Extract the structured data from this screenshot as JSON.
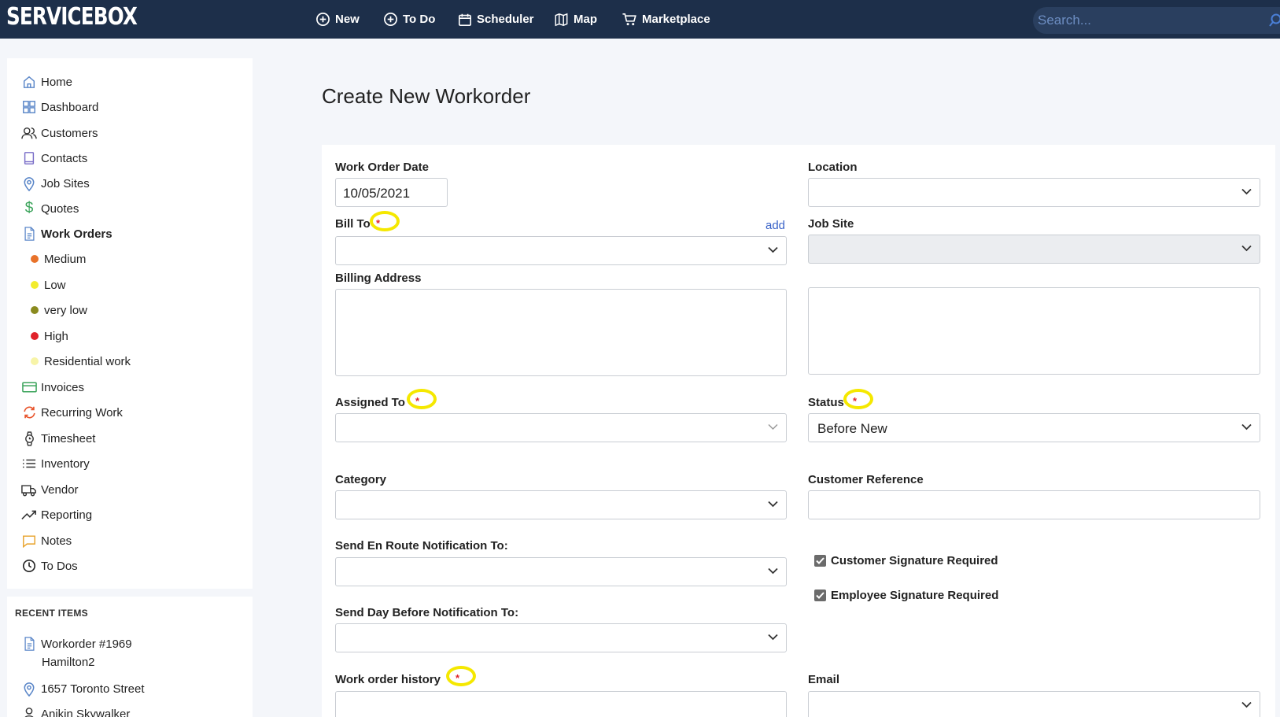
{
  "brand": "SERVICEBOX",
  "nav": [
    {
      "label": "New",
      "icon": "plus-circle-icon"
    },
    {
      "label": "To Do",
      "icon": "plus-circle-icon"
    },
    {
      "label": "Scheduler",
      "icon": "calendar-icon"
    },
    {
      "label": "Map",
      "icon": "map-icon"
    },
    {
      "label": "Marketplace",
      "icon": "cart-icon"
    }
  ],
  "search": {
    "placeholder": "Search..."
  },
  "sidebar": {
    "items": [
      {
        "label": "Home",
        "icon": "home-icon"
      },
      {
        "label": "Dashboard",
        "icon": "dashboard-icon"
      },
      {
        "label": "Customers",
        "icon": "users-icon"
      },
      {
        "label": "Contacts",
        "icon": "book-icon"
      },
      {
        "label": "Job Sites",
        "icon": "location-pin-icon"
      },
      {
        "label": "Quotes",
        "icon": "dollar-icon"
      },
      {
        "label": "Work Orders",
        "icon": "document-icon"
      },
      {
        "label": "Invoices",
        "icon": "credit-card-icon"
      },
      {
        "label": "Recurring Work",
        "icon": "refresh-icon"
      },
      {
        "label": "Timesheet",
        "icon": "watch-icon"
      },
      {
        "label": "Inventory",
        "icon": "list-icon"
      },
      {
        "label": "Vendor",
        "icon": "truck-icon"
      },
      {
        "label": "Reporting",
        "icon": "trend-icon"
      },
      {
        "label": "Notes",
        "icon": "chat-icon"
      },
      {
        "label": "To Dos",
        "icon": "clock-icon"
      }
    ],
    "work_order_priorities": [
      {
        "label": "Medium",
        "color": "#e8722a"
      },
      {
        "label": "Low",
        "color": "#f2ec2e"
      },
      {
        "label": "very low",
        "color": "#8a8a1e"
      },
      {
        "label": "High",
        "color": "#e0222a"
      },
      {
        "label": "Residential work",
        "color": "#f7f4a8"
      }
    ]
  },
  "recent": {
    "title": "RECENT ITEMS",
    "items": [
      {
        "title": "Workorder #1969",
        "subtitle": "Hamilton2",
        "icon": "document-icon"
      },
      {
        "title": "1657 Toronto Street",
        "icon": "location-pin-icon"
      },
      {
        "title": "Anikin Skywalker",
        "icon": "user-icon"
      }
    ]
  },
  "page": {
    "title": "Create New Workorder"
  },
  "form": {
    "work_order_date": {
      "label": "Work Order Date",
      "value": "10/05/2021"
    },
    "location": {
      "label": "Location",
      "value": ""
    },
    "bill_to": {
      "label": "Bill To",
      "required_mark": "*",
      "add_link": "add",
      "value": ""
    },
    "job_site": {
      "label": "Job Site",
      "value": ""
    },
    "billing_address": {
      "label": "Billing Address",
      "value": ""
    },
    "assigned_to": {
      "label": "Assigned To",
      "required_mark": "*",
      "value": ""
    },
    "status": {
      "label": "Status",
      "required_mark": "*",
      "value": "Before New"
    },
    "category": {
      "label": "Category",
      "value": ""
    },
    "customer_reference": {
      "label": "Customer Reference",
      "value": ""
    },
    "en_route": {
      "label": "Send En Route Notification To:",
      "value": ""
    },
    "customer_signature": {
      "label": "Customer Signature Required",
      "checked": true
    },
    "employee_signature": {
      "label": "Employee Signature Required",
      "checked": true
    },
    "day_before": {
      "label": "Send Day Before Notification To:",
      "value": ""
    },
    "history": {
      "label": "Work order history",
      "required_mark": "*",
      "value": ""
    },
    "email": {
      "label": "Email",
      "value": ""
    }
  }
}
